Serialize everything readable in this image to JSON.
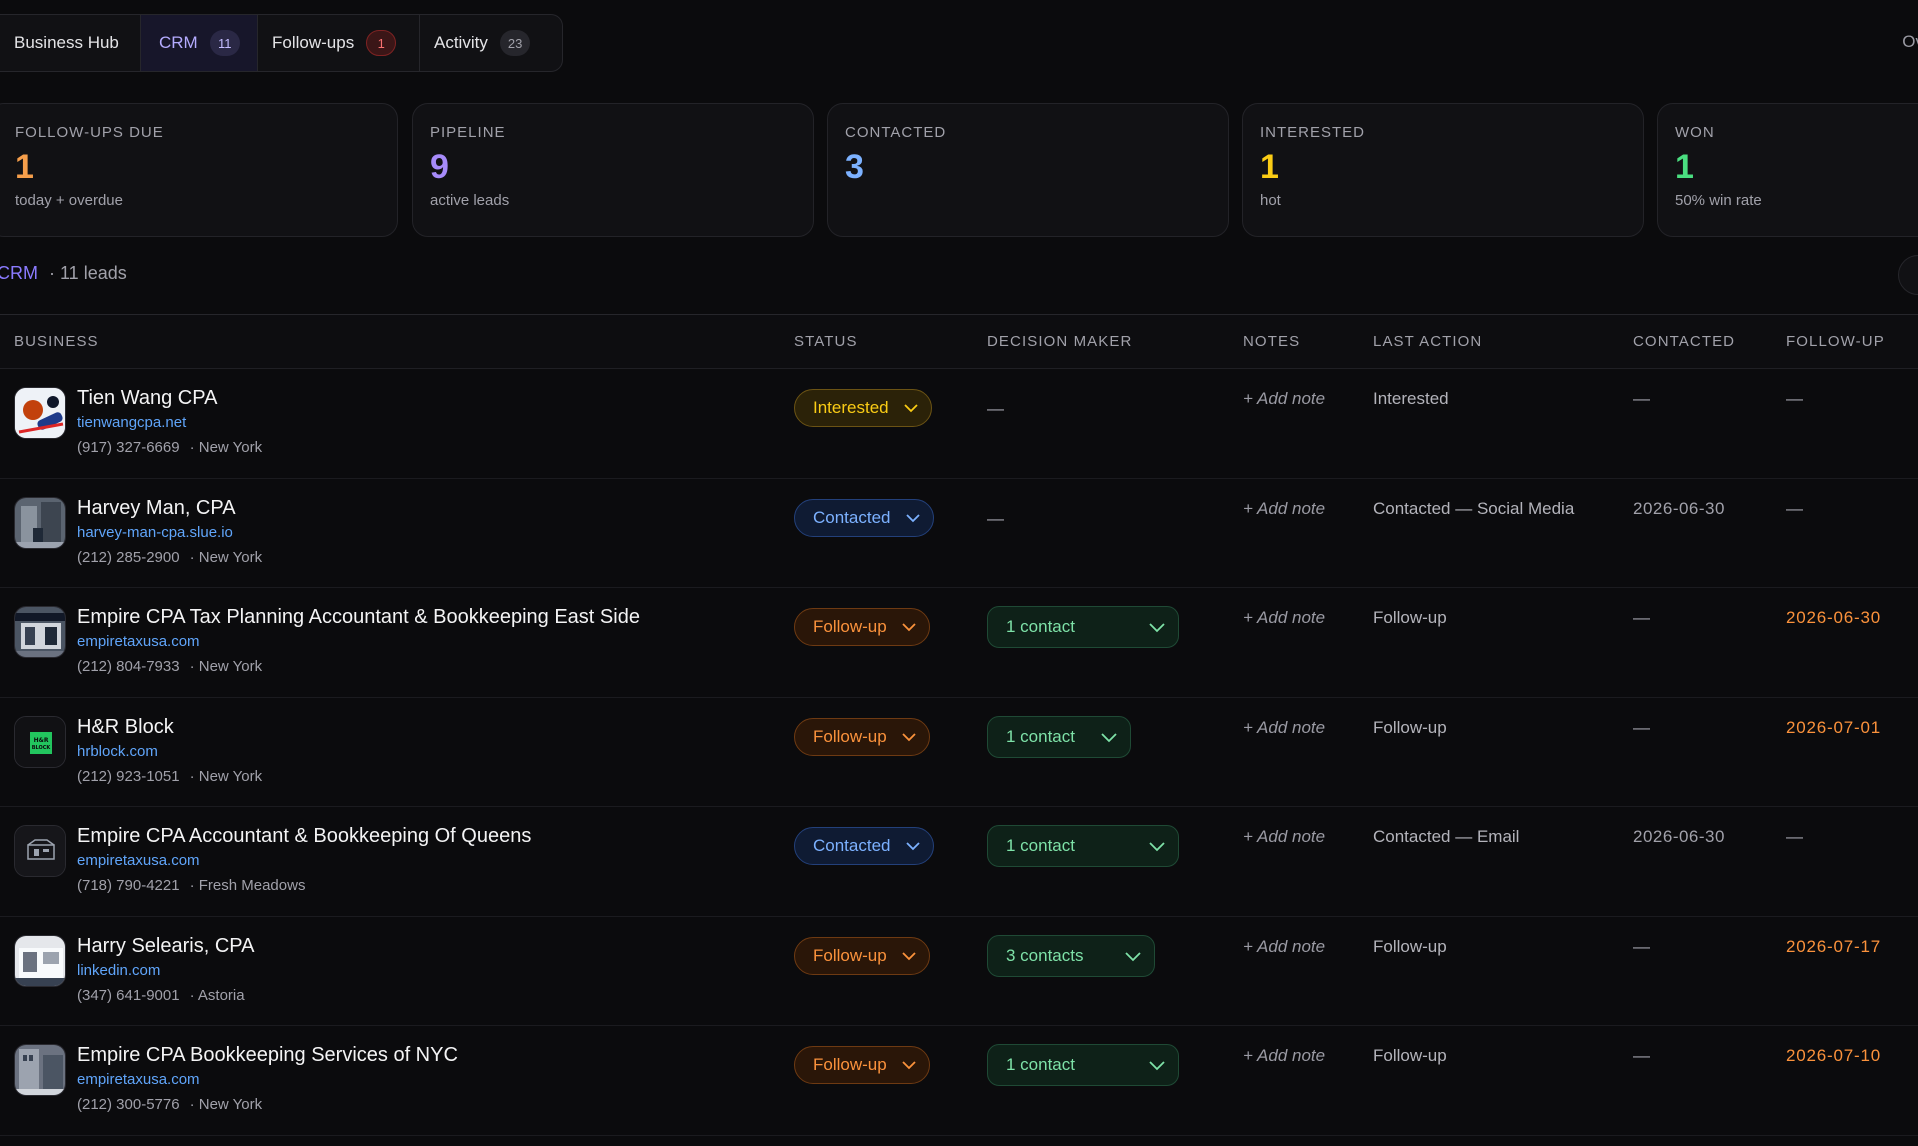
{
  "tabs": [
    {
      "label": "Business Hub",
      "count": ""
    },
    {
      "label": "CRM",
      "count": "11"
    },
    {
      "label": "Follow-ups",
      "count": "1"
    },
    {
      "label": "Activity",
      "count": "23"
    }
  ],
  "top_right_cut": "Ov",
  "stats": [
    {
      "label": "FOLLOW-UPS DUE",
      "value": "1",
      "sub": "today + overdue",
      "color": "#f59e4b"
    },
    {
      "label": "PIPELINE",
      "value": "9",
      "sub": "active leads",
      "color": "#a78bfa"
    },
    {
      "label": "CONTACTED",
      "value": "3",
      "sub": "",
      "color": "#7cb1ff"
    },
    {
      "label": "INTERESTED",
      "value": "1",
      "sub": "hot",
      "color": "#facc15"
    },
    {
      "label": "WON",
      "value": "1",
      "sub": "50% win rate",
      "color": "#4ade80"
    }
  ],
  "section": {
    "title": "CRM",
    "count": "· 11 leads"
  },
  "columns": {
    "business": "BUSINESS",
    "status": "STATUS",
    "decision_maker": "DECISION MAKER",
    "notes": "NOTES",
    "last_action": "LAST ACTION",
    "contacted": "CONTACTED",
    "follow_up": "FOLLOW-UP"
  },
  "rows": [
    {
      "name": "Tien Wang CPA",
      "site": "tienwangcpa.net",
      "phone": "(917) 327-6669",
      "city": "· New York",
      "status": "Interested",
      "dm": "—",
      "note": "+ Add note",
      "last": "Interested",
      "contacted": "—",
      "follow": "—"
    },
    {
      "name": "Harvey Man, CPA",
      "site": "harvey-man-cpa.slue.io",
      "phone": "(212) 285-2900",
      "city": "· New York",
      "status": "Contacted",
      "dm": "—",
      "note": "+ Add note",
      "last": "Contacted — Social Media",
      "contacted": "2026-06-30",
      "follow": "—"
    },
    {
      "name": "Empire CPA Tax Planning Accountant & Bookkeeping East Side",
      "site": "empiretaxusa.com",
      "phone": "(212) 804-7933",
      "city": "· New York",
      "status": "Follow-up",
      "dm": "1 contact",
      "note": "+ Add note",
      "last": "Follow-up",
      "contacted": "—",
      "follow": "2026-06-30"
    },
    {
      "name": "H&R Block",
      "site": "hrblock.com",
      "phone": "(212) 923-1051",
      "city": "· New York",
      "status": "Follow-up",
      "dm": "1 contact",
      "note": "+ Add note",
      "last": "Follow-up",
      "contacted": "—",
      "follow": "2026-07-01"
    },
    {
      "name": "Empire CPA Accountant & Bookkeeping Of Queens",
      "site": "empiretaxusa.com",
      "phone": "(718) 790-4221",
      "city": "· Fresh Meadows",
      "status": "Contacted",
      "dm": "1 contact",
      "note": "+ Add note",
      "last": "Contacted — Email",
      "contacted": "2026-06-30",
      "follow": "—"
    },
    {
      "name": "Harry Selearis, CPA",
      "site": "linkedin.com",
      "phone": "(347) 641-9001",
      "city": "· Astoria",
      "status": "Follow-up",
      "dm": "3 contacts",
      "note": "+ Add note",
      "last": "Follow-up",
      "contacted": "—",
      "follow": "2026-07-17"
    },
    {
      "name": "Empire CPA Bookkeeping Services of NYC",
      "site": "empiretaxusa.com",
      "phone": "(212) 300-5776",
      "city": "· New York",
      "status": "Follow-up",
      "dm": "1 contact",
      "note": "+ Add note",
      "last": "Follow-up",
      "contacted": "—",
      "follow": "2026-07-10"
    }
  ]
}
